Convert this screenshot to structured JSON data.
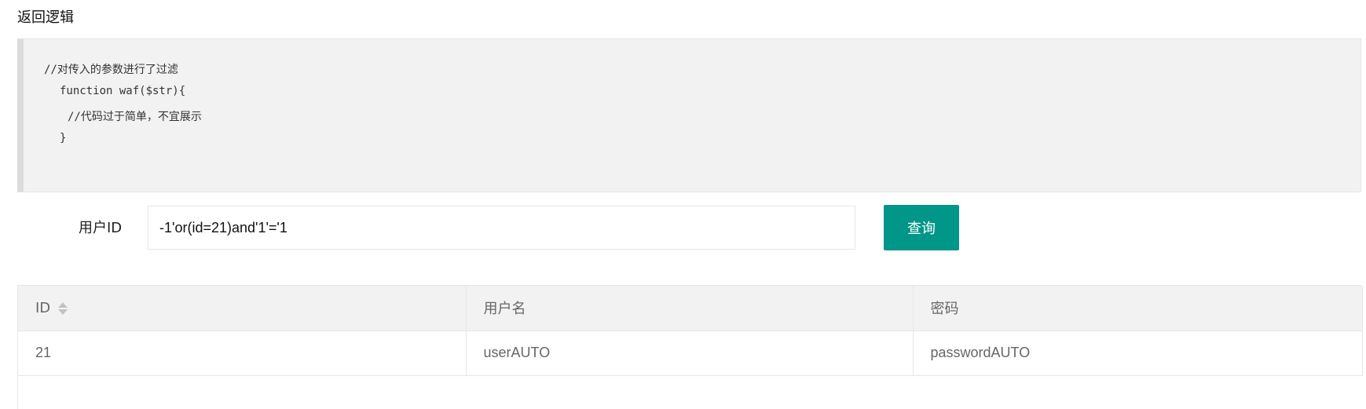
{
  "section": {
    "title": "返回逻辑"
  },
  "code": {
    "lines": [
      "//对传入的参数进行了过滤",
      "function waf($str){",
      "//代码过于简单，不宜展示",
      "}"
    ]
  },
  "form": {
    "label": "用户ID",
    "input_value": "-1'or(id=21)and'1'='1",
    "button_label": "查询"
  },
  "table": {
    "columns": [
      "ID",
      "用户名",
      "密码"
    ],
    "rows": [
      [
        "21",
        "userAUTO",
        "passwordAUTO"
      ]
    ]
  },
  "colors": {
    "accent": "#009688",
    "code_bg": "#f2f2f2",
    "border": "#e6e6e6"
  },
  "icons": {
    "sort": "sort-icon"
  }
}
